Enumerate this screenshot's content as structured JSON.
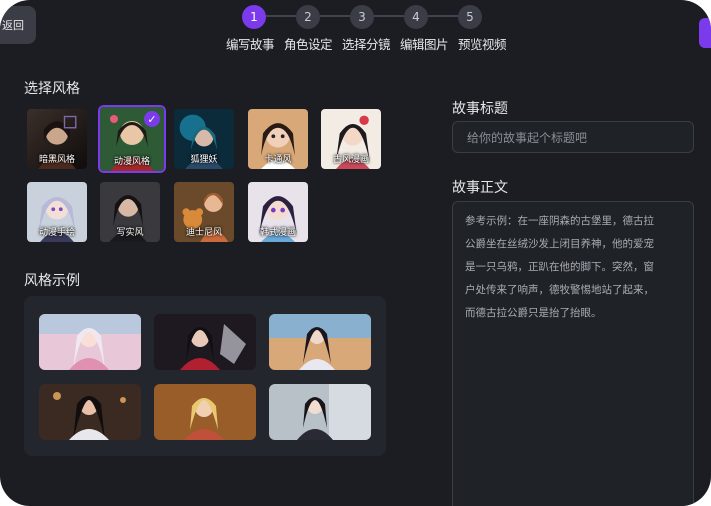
{
  "header": {
    "back_label": "返回",
    "steps": [
      {
        "number": "1",
        "label": "编写故事",
        "active": true
      },
      {
        "number": "2",
        "label": "角色设定",
        "active": false
      },
      {
        "number": "3",
        "label": "选择分镜",
        "active": false
      },
      {
        "number": "4",
        "label": "编辑图片",
        "active": false
      },
      {
        "number": "5",
        "label": "预览视频",
        "active": false
      }
    ]
  },
  "style_section": {
    "title": "选择风格",
    "styles": [
      {
        "label": "暗黑风格",
        "selected": false
      },
      {
        "label": "动漫风格",
        "selected": true
      },
      {
        "label": "狐狸妖",
        "selected": false
      },
      {
        "label": "卡通风",
        "selected": false
      },
      {
        "label": "古风漫画",
        "selected": false
      },
      {
        "label": "动漫手绘",
        "selected": false
      },
      {
        "label": "写实风",
        "selected": false
      },
      {
        "label": "迪士尼风",
        "selected": false
      },
      {
        "label": "韩式漫画",
        "selected": false
      }
    ]
  },
  "example_section": {
    "title": "风格示例"
  },
  "story_title": {
    "label": "故事标题",
    "placeholder": "给你的故事起个标题吧"
  },
  "story_body": {
    "label": "故事正文",
    "lines": [
      "参考示例：在一座阴森的古堡里，德古拉",
      "公爵坐在丝绒沙发上闭目养神，他的爱宠",
      "是一只乌鸦，正趴在他的脚下。突然，窗",
      "户处传来了响声，德牧警惕地站了起来，",
      "而德古拉公爵只是抬了抬眼。"
    ]
  },
  "colors": {
    "accent": "#7c3aed",
    "background": "#1b1d22",
    "panel": "#23262d"
  }
}
